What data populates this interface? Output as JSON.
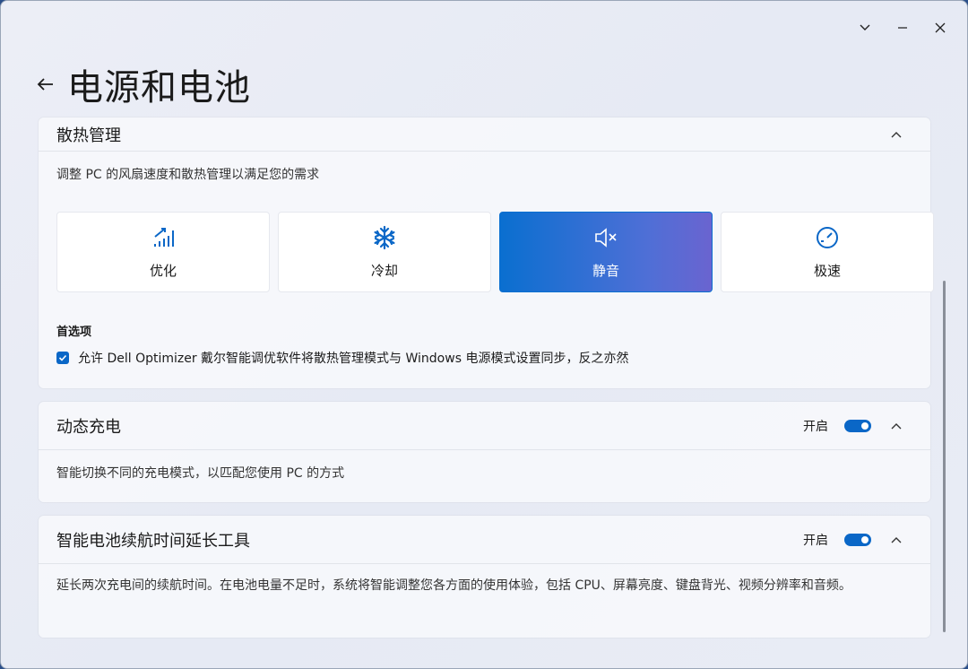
{
  "window": {
    "title": "电源和电池"
  },
  "controls": {
    "minimize": "–",
    "close": "✕",
    "dropdown": "⌄"
  },
  "thermal": {
    "title": "散热管理",
    "description": "调整 PC 的风扇速度和散热管理以满足您的需求",
    "modes": [
      {
        "label": "优化",
        "icon": "signal-bars-icon",
        "active": false
      },
      {
        "label": "冷却",
        "icon": "snowflake-icon",
        "active": false
      },
      {
        "label": "静音",
        "icon": "speaker-mute-icon",
        "active": true
      },
      {
        "label": "极速",
        "icon": "speedometer-icon",
        "active": false
      }
    ],
    "preferences_title": "首选项",
    "sync_option": {
      "label": "允许 Dell Optimizer 戴尔智能调优软件将散热管理模式与 Windows 电源模式设置同步，反之亦然",
      "checked": true
    }
  },
  "dynamic_charging": {
    "title": "动态充电",
    "toggle_label": "开启",
    "enabled": true,
    "description": "智能切换不同的充电模式，以匹配您使用 PC 的方式"
  },
  "battery_extender": {
    "title": "智能电池续航时间延长工具",
    "toggle_label": "开启",
    "enabled": true,
    "description": "延长两次充电间的续航时间。在电池电量不足时，系统将智能调整您各方面的使用体验，包括 CPU、屏幕亮度、键盘背光、视频分辨率和音频。"
  },
  "colors": {
    "accent": "#0a67c7",
    "active_gradient_end": "#6a64d0"
  }
}
